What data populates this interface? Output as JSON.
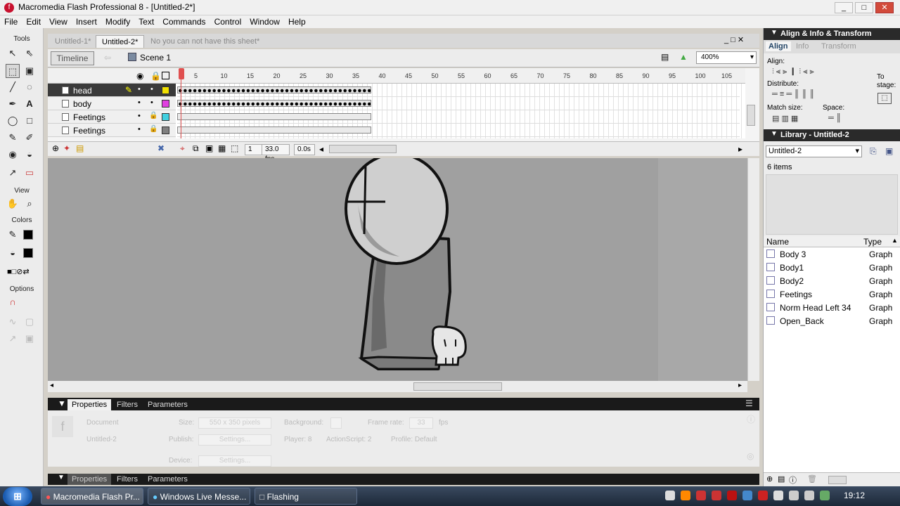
{
  "window": {
    "title": "Macromedia Flash Professional 8 - [Untitled-2*]",
    "min": "_",
    "max": "□",
    "close": "✕"
  },
  "menu": [
    "File",
    "Edit",
    "View",
    "Insert",
    "Modify",
    "Text",
    "Commands",
    "Control",
    "Window",
    "Help"
  ],
  "tools": {
    "title": "Tools",
    "view_title": "View",
    "colors_title": "Colors",
    "options_title": "Options"
  },
  "doc_tabs": [
    "Untitled-1*",
    "Untitled-2*",
    "No you can not have this sheet*"
  ],
  "editbar": {
    "timeline_label": "Timeline",
    "scene_label": "Scene 1",
    "zoom": "400%"
  },
  "timeline": {
    "ruler": [
      "5",
      "10",
      "15",
      "20",
      "25",
      "30",
      "35",
      "40",
      "45",
      "50",
      "55",
      "60",
      "65",
      "70",
      "75",
      "80",
      "85",
      "90",
      "95",
      "100",
      "105"
    ],
    "layers": [
      {
        "name": "head",
        "color": "#f0e000",
        "selected": true
      },
      {
        "name": "body",
        "color": "#e040e0",
        "selected": false
      },
      {
        "name": "Feetings",
        "color": "#40d0e0",
        "selected": false
      },
      {
        "name": "Feetings",
        "color": "#808080",
        "selected": false
      }
    ],
    "current_frame": "1",
    "fps": "33.0 fps",
    "time": "0.0s"
  },
  "properties": {
    "tabs": [
      "Properties",
      "Filters",
      "Parameters"
    ],
    "doc_label": "Document",
    "doc_name": "Untitled-2",
    "size_label": "Size:",
    "size_value": "550 x 350 pixels",
    "background_label": "Background:",
    "framerate_label": "Frame rate:",
    "framerate_value": "33",
    "fps_unit": "fps",
    "publish_label": "Publish:",
    "settings_btn": "Settings...",
    "player_label": "Player: 8",
    "actionscript_label": "ActionScript: 2",
    "profile_label": "Profile: Default",
    "device_label": "Device:"
  },
  "align_panel": {
    "header": "Align & Info & Transform",
    "tabs": [
      "Align",
      "Info",
      "Transform"
    ],
    "align_label": "Align:",
    "distribute_label": "Distribute:",
    "match_label": "Match size:",
    "space_label": "Space:",
    "tostage_label": "To",
    "tostage_label2": "stage:"
  },
  "library": {
    "header": "Library - Untitled-2",
    "doc_select": "Untitled-2",
    "count": "6 items",
    "col_name": "Name",
    "col_type": "Type",
    "items": [
      {
        "name": "Body 3",
        "type": "Graph"
      },
      {
        "name": "Body1",
        "type": "Graph"
      },
      {
        "name": "Body2",
        "type": "Graph"
      },
      {
        "name": "Feetings",
        "type": "Graph"
      },
      {
        "name": "Norm Head Left 34",
        "type": "Graph"
      },
      {
        "name": "Open_Back",
        "type": "Graph"
      }
    ]
  },
  "taskbar": {
    "tasks": [
      "Macromedia Flash Pr...",
      "Windows Live Messe...",
      "Flashing"
    ],
    "clock": "19:12"
  }
}
